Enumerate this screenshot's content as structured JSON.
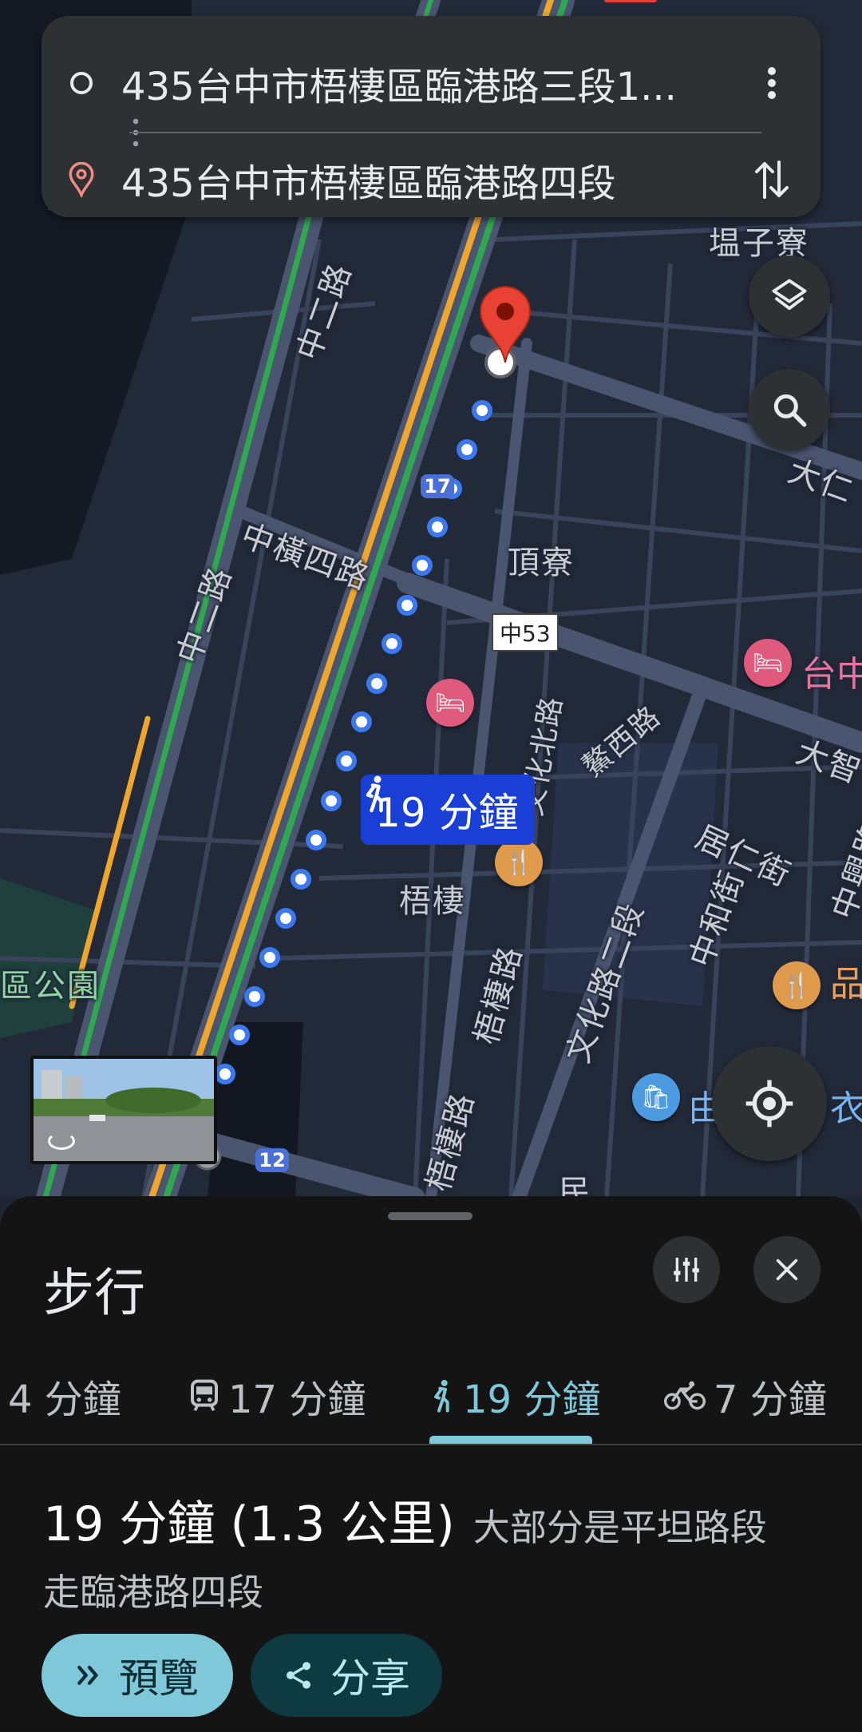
{
  "route": {
    "origin": "435台中市梧棲區臨港路三段1...",
    "destination": "435台中市梧棲區臨港路四段"
  },
  "map": {
    "labels": {
      "zhonger_road_top": "中二路",
      "zhonger_road_left": "中二路",
      "zhongheng_4": "中橫四路",
      "dingliao": "頂寮",
      "wuqi": "梧棲",
      "tazi_liao": "塭子寮",
      "daren": "大仁",
      "dazhi": "大智",
      "park": "區公園",
      "wuqi_road_1": "梧棲路",
      "wuqi_road_2": "梧棲路",
      "wenhua_road": "文化路二段",
      "zhonghe_st": "中和街",
      "juren_st": "居仁街",
      "zhongxing_road": "中興路",
      "wenhua_north": "文化北路",
      "jingxi_road": "鰲西路",
      "poi_taizhong": "台中",
      "poi_pin": "品",
      "poi_you": "由",
      "poi_yi": "衣",
      "min": "民"
    },
    "shields": {
      "route17": "17",
      "route12": "12",
      "zhong53": "中53"
    },
    "walk_callout": "19 分鐘"
  },
  "sheet": {
    "title": "步行",
    "tabs": [
      {
        "label": "4 分鐘",
        "icon": "car-icon"
      },
      {
        "label": "17 分鐘",
        "icon": "transit-icon"
      },
      {
        "label": "19 分鐘",
        "icon": "walk-icon"
      },
      {
        "label": "7 分鐘",
        "icon": "bike-icon"
      }
    ],
    "summary_main": "19 分鐘 (1.3 公里)",
    "summary_sub": "大部分是平坦路段",
    "via": "走臨港路四段",
    "preview_label": "預覽",
    "share_label": "分享"
  },
  "colors": {
    "accent": "#7fc8d9",
    "route_blue": "#3c78f0",
    "pin_red": "#e94235"
  }
}
